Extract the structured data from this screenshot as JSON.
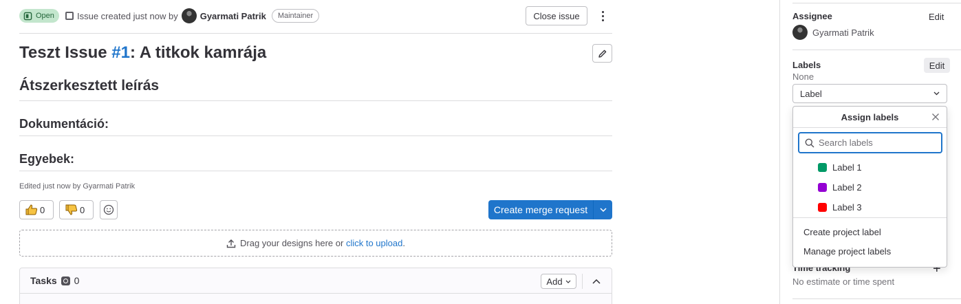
{
  "header": {
    "status": "Open",
    "created_text": "Issue created just now by",
    "author": "Gyarmati Patrik",
    "role": "Maintainer",
    "close_button": "Close issue"
  },
  "issue": {
    "title_prefix": "Teszt Issue",
    "title_ref": "#1",
    "title_suffix": ": A titkok kamrája",
    "heading": "Átszerkesztett leírás",
    "section_1": "Dokumentáció:",
    "section_2": "Egyebek:",
    "edited_text": "Edited just now by Gyarmati Patrik"
  },
  "reactions": {
    "thumbs_up_count": "0",
    "thumbs_down_count": "0"
  },
  "actions": {
    "create_mr": "Create merge request"
  },
  "designs": {
    "drop_text": "Drag your designs here or",
    "upload_link": "click to upload",
    "period": "."
  },
  "tasks": {
    "title": "Tasks",
    "count": "0",
    "add_label": "Add"
  },
  "sidebar": {
    "assignee_label": "Assignee",
    "assignee_edit": "Edit",
    "assignee_name": "Gyarmati Patrik",
    "labels_label": "Labels",
    "labels_edit": "Edit",
    "labels_value": "None",
    "label_select": "Label",
    "time_tracking_label": "Time tracking",
    "time_tracking_value": "No estimate or time spent"
  },
  "label_dropdown": {
    "title": "Assign labels",
    "search_placeholder": "Search labels",
    "items": [
      {
        "name": "Label 1",
        "color": "#009966"
      },
      {
        "name": "Label 2",
        "color": "#9400d3"
      },
      {
        "name": "Label 3",
        "color": "#ff0000"
      }
    ],
    "create_link": "Create project label",
    "manage_link": "Manage project labels"
  }
}
